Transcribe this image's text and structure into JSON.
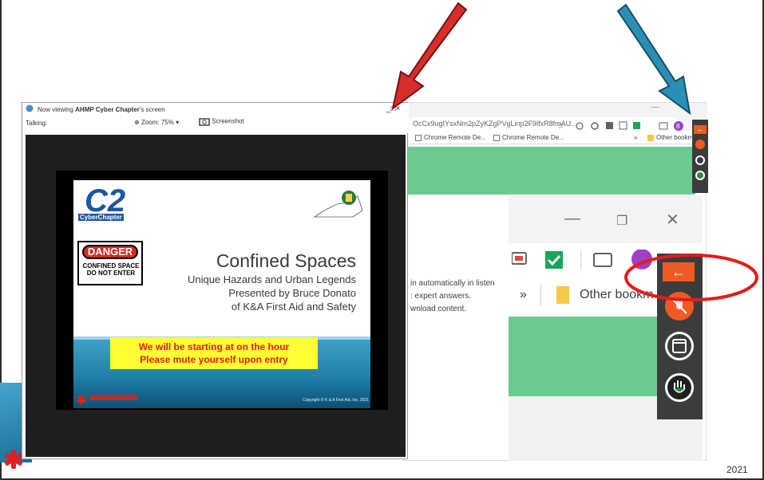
{
  "zoom_share": {
    "now_viewing_prefix": "Now viewing ",
    "now_viewing_name": "AHMP Cyber Chapter",
    "now_viewing_suffix": "'s screen",
    "talking_label": "Talking:",
    "zoom_label": "Zoom: 75%",
    "screenshot_label": "Screenshot"
  },
  "slide": {
    "logo_c2": "C2",
    "logo_chapter": "CyberChapter",
    "danger_label": "DANGER",
    "danger_sub": "CONFINED SPACE\nDO NOT ENTER",
    "title": "Confined Spaces",
    "line1": "Unique Hazards and Urban Legends",
    "line2": "Presented by Bruce Donato",
    "line3": "of K&A First Aid and Safety",
    "notice_line1": "We will be starting at on the hour",
    "notice_line2": "Please mute yourself upon entry",
    "copyright": "Copyright © K & A First Aid, Inc. 2021"
  },
  "chrome": {
    "url": "OcCx9ugIYsxNm2pZyKZgPVgLinp2F9lfxR8fmAU...",
    "bookmarks": [
      "Chrome Remote De...",
      "Chrome Remote De...",
      "Other bookm"
    ],
    "page_text": [
      "in automatically in listen",
      ": expert answers.",
      "wnload content."
    ],
    "zoomed_bookmark_chevron": "»",
    "zoomed_bookmark": "Other bookm"
  },
  "slide_footer": {
    "year": "2021"
  },
  "colors": {
    "red_arrow": "#d62d2d",
    "blue_arrow": "#2b8fb5",
    "chrome_green": "#6ccb91",
    "crd_orange": "#ef5a24",
    "notice_yellow": "#ffff33",
    "notice_red": "#e41b1b"
  }
}
